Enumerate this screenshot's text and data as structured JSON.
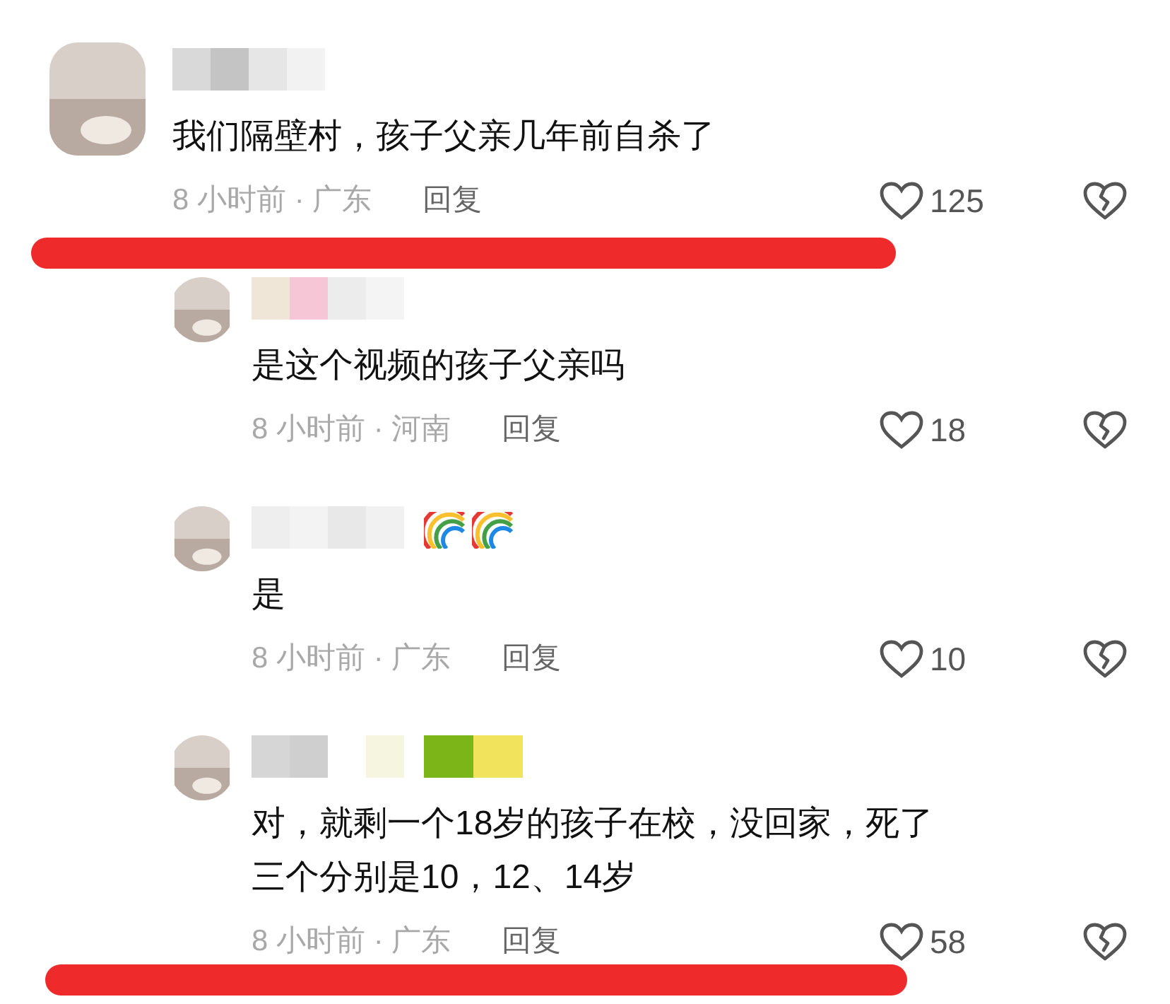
{
  "comments": [
    {
      "lines": [
        "我们隔壁村，孩子父亲几年前自杀了"
      ],
      "time": "8 小时前 · 广东",
      "reply": "回复",
      "likes": "125",
      "replies": [
        {
          "lines": [
            "是这个视频的孩子父亲吗"
          ],
          "time": "8 小时前 · 河南",
          "reply": "回复",
          "likes": "18"
        },
        {
          "lines": [
            "是"
          ],
          "time": "8 小时前 · 广东",
          "reply": "回复",
          "likes": "10"
        },
        {
          "lines": [
            "对，就剩一个18岁的孩子在校，没回家，死了",
            "三个分别是10，12、14岁"
          ],
          "time": "8 小时前 · 广东",
          "reply": "回复",
          "likes": "58"
        }
      ]
    }
  ]
}
